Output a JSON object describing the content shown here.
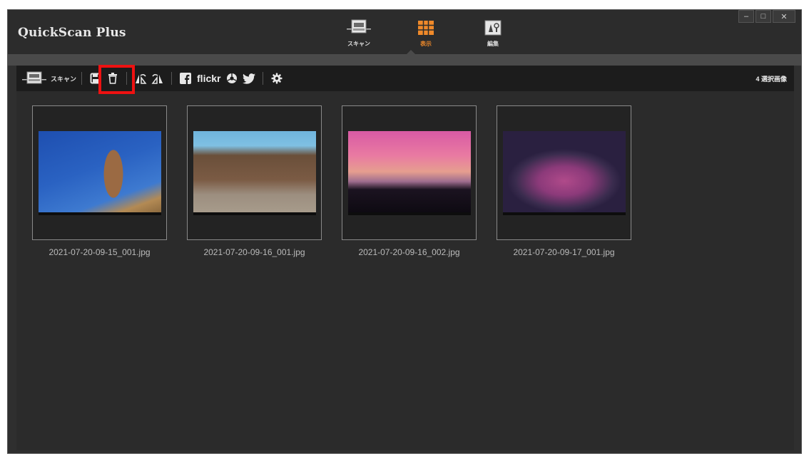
{
  "app": {
    "title": "QuickScan Plus"
  },
  "modes": [
    {
      "label": "スキャン",
      "icon": "scanner-icon",
      "active": false
    },
    {
      "label": "表示",
      "icon": "grid-view-icon",
      "active": true
    },
    {
      "label": "編集",
      "icon": "edit-tools-icon",
      "active": false
    }
  ],
  "window_controls": {
    "minimize": "–",
    "maximize": "□",
    "close": "✕"
  },
  "toolbar": {
    "scan_label": "スキャン",
    "flickr_label": "flickr",
    "selected_count": "4 選択画像",
    "icons": [
      "save-icon",
      "trash-icon",
      "rotate-left-icon",
      "rotate-right-icon",
      "facebook-icon",
      "flickr-icon",
      "picasa-icon",
      "twitter-icon",
      "gear-icon"
    ]
  },
  "images": [
    {
      "filename": "2021-07-20-09-15_001.jpg"
    },
    {
      "filename": "2021-07-20-09-16_001.jpg"
    },
    {
      "filename": "2021-07-20-09-16_002.jpg"
    },
    {
      "filename": "2021-07-20-09-17_001.jpg"
    }
  ],
  "colors": {
    "accent": "#f08a2a",
    "highlight": "#ee1111",
    "background": "#2b2b2b"
  }
}
